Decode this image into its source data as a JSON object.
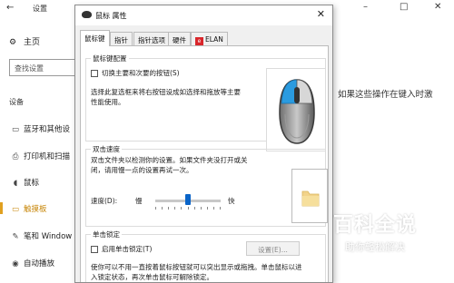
{
  "settings": {
    "title": "设置",
    "back_icon": "←",
    "controls": {
      "minimize": "–",
      "maximize": "□",
      "close": "✕"
    },
    "home_label": "主页",
    "search_placeholder": "查找设置",
    "section_label": "设备",
    "nav_items": [
      {
        "label": "蓝牙和其他设",
        "icon": "bluetooth-devices-icon",
        "glyph": "▭"
      },
      {
        "label": "打印机和扫描",
        "icon": "printer-icon",
        "glyph": "⎙"
      },
      {
        "label": "鼠标",
        "icon": "mouse-icon",
        "glyph": "◖"
      },
      {
        "label": "触摸板",
        "icon": "touchpad-icon",
        "glyph": "▭"
      },
      {
        "label": "笔和 Window",
        "icon": "pen-icon",
        "glyph": "✎"
      },
      {
        "label": "自动播放",
        "icon": "autoplay-icon",
        "glyph": "◉"
      }
    ],
    "active_item": "触摸板",
    "right_text": "如果这些操作在键入时激"
  },
  "dialog": {
    "title": "鼠标 属性",
    "close": "✕",
    "tabs": [
      {
        "label": "鼠标键",
        "active": true
      },
      {
        "label": "指针",
        "active": false
      },
      {
        "label": "指针选项",
        "active": false
      },
      {
        "label": "硬件",
        "active": false
      },
      {
        "label": "ELAN",
        "active": false,
        "badge": "e"
      }
    ],
    "button_config": {
      "group_label": "鼠标键配置",
      "checkbox_label": "切换主要和次要的按钮(S)",
      "checked": false,
      "description": [
        "选择此复选框来将右按钮设成如选择和拖放等主要",
        "性能使用。"
      ]
    },
    "double_click": {
      "group_label": "双击速度",
      "description": [
        "双击文件夹以检测你的设置。如果文件夹没打开或关",
        "闭，请用慢一点的设置再试一次。"
      ],
      "speed_label": "速度(D):",
      "slow_label": "慢",
      "fast_label": "快",
      "speed_value": 0.5
    },
    "click_lock": {
      "group_label": "单击锁定",
      "checkbox_label": "启用单击锁定(T)",
      "checked": false,
      "settings_button": "设置(E)...",
      "description": [
        "使你可以不用一直按着鼠标按钮就可以突出显示或拖拽。单击鼠标以进",
        "入锁定状态，再次单击鼠标可解除锁定。"
      ]
    }
  },
  "watermark": {
    "title": "百科全说",
    "subtitle": "助你轻松解决"
  },
  "colors": {
    "accent": "#0a64c8",
    "active_nav": "#c8870a",
    "elan_red": "#d9262b"
  }
}
